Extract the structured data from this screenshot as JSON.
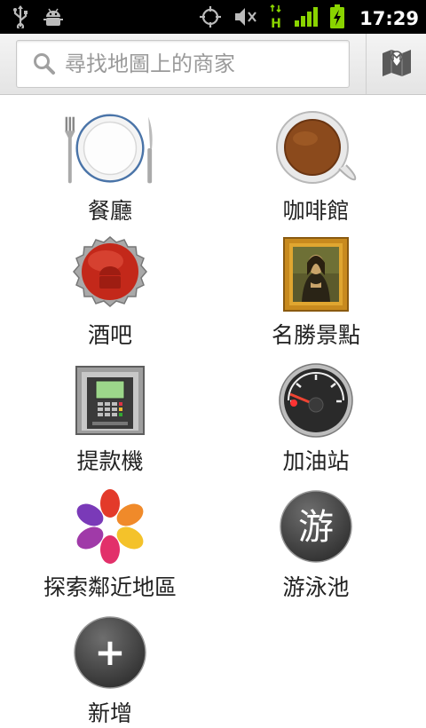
{
  "status_bar": {
    "time": "17:29",
    "network_type": "H",
    "left_icons": [
      "usb-icon",
      "android-debug-icon"
    ],
    "right_icons": [
      "gps-icon",
      "mute-icon",
      "data-h-icon",
      "signal-icon",
      "battery-charging-icon"
    ]
  },
  "search": {
    "placeholder": "尋找地圖上的商家",
    "map_button_icon": "map-icon"
  },
  "places": [
    {
      "label": "餐廳",
      "icon": "restaurant-icon"
    },
    {
      "label": "咖啡館",
      "icon": "coffee-icon"
    },
    {
      "label": "酒吧",
      "icon": "bar-icon"
    },
    {
      "label": "名勝景點",
      "icon": "attractions-icon"
    },
    {
      "label": "提款機",
      "icon": "atm-icon"
    },
    {
      "label": "加油站",
      "icon": "gas-station-icon"
    },
    {
      "label": "探索鄰近地區",
      "icon": "explore-icon"
    },
    {
      "label": "游泳池",
      "icon": "pool-icon",
      "icon_text": "游"
    },
    {
      "label": "新增",
      "icon": "add-icon",
      "icon_text": "+"
    }
  ]
}
